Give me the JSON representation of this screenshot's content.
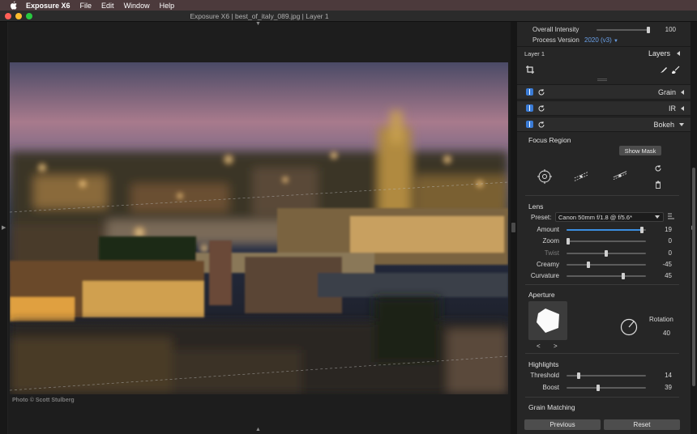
{
  "menubar": {
    "app": "Exposure X6",
    "items": [
      "File",
      "Edit",
      "Window",
      "Help"
    ]
  },
  "window": {
    "title": "Exposure X6 | best_of_italy_089.jpg | Layer 1"
  },
  "photo": {
    "credit": "Photo © Scott Stulberg"
  },
  "panel": {
    "overall_intensity": {
      "label": "Overall Intensity",
      "value": "100",
      "fraction": 1.0
    },
    "process_version": {
      "label": "Process Version",
      "value": "2020 (v3)"
    },
    "layer": {
      "name": "Layer 1",
      "tab": "Layers"
    },
    "sections": {
      "grain": "Grain",
      "ir": "IR",
      "bokeh": "Bokeh"
    },
    "focus_region": {
      "title": "Focus Region",
      "show_mask": "Show Mask"
    },
    "lens": {
      "title": "Lens",
      "preset_label": "Preset:",
      "preset_value": "Canon  50mm f/1.8 @ f/5.6*",
      "sliders": [
        {
          "name": "Amount",
          "value": "19",
          "fraction": 0.97,
          "dim": false,
          "fill": true
        },
        {
          "name": "Zoom",
          "value": "0",
          "fraction": 0.0,
          "dim": false,
          "fill": false
        },
        {
          "name": "Twist",
          "value": "0",
          "fraction": 0.5,
          "dim": true,
          "fill": false
        },
        {
          "name": "Creamy",
          "value": "-45",
          "fraction": 0.27,
          "dim": false,
          "fill": false
        },
        {
          "name": "Curvature",
          "value": "45",
          "fraction": 0.72,
          "dim": false,
          "fill": false
        }
      ]
    },
    "aperture": {
      "title": "Aperture",
      "rotation_label": "Rotation",
      "rotation_value": "40",
      "prev": "<",
      "next": ">"
    },
    "highlights": {
      "title": "Highlights",
      "sliders": [
        {
          "name": "Threshold",
          "value": "14",
          "fraction": 0.14
        },
        {
          "name": "Boost",
          "value": "39",
          "fraction": 0.39
        }
      ]
    },
    "grain_matching": {
      "title": "Grain Matching"
    },
    "buttons": {
      "previous": "Previous",
      "reset": "Reset"
    }
  },
  "colors": {
    "accent": "#3b8ee0",
    "toggle": "#3a7bd5",
    "menubar": "#4c3a3c"
  }
}
